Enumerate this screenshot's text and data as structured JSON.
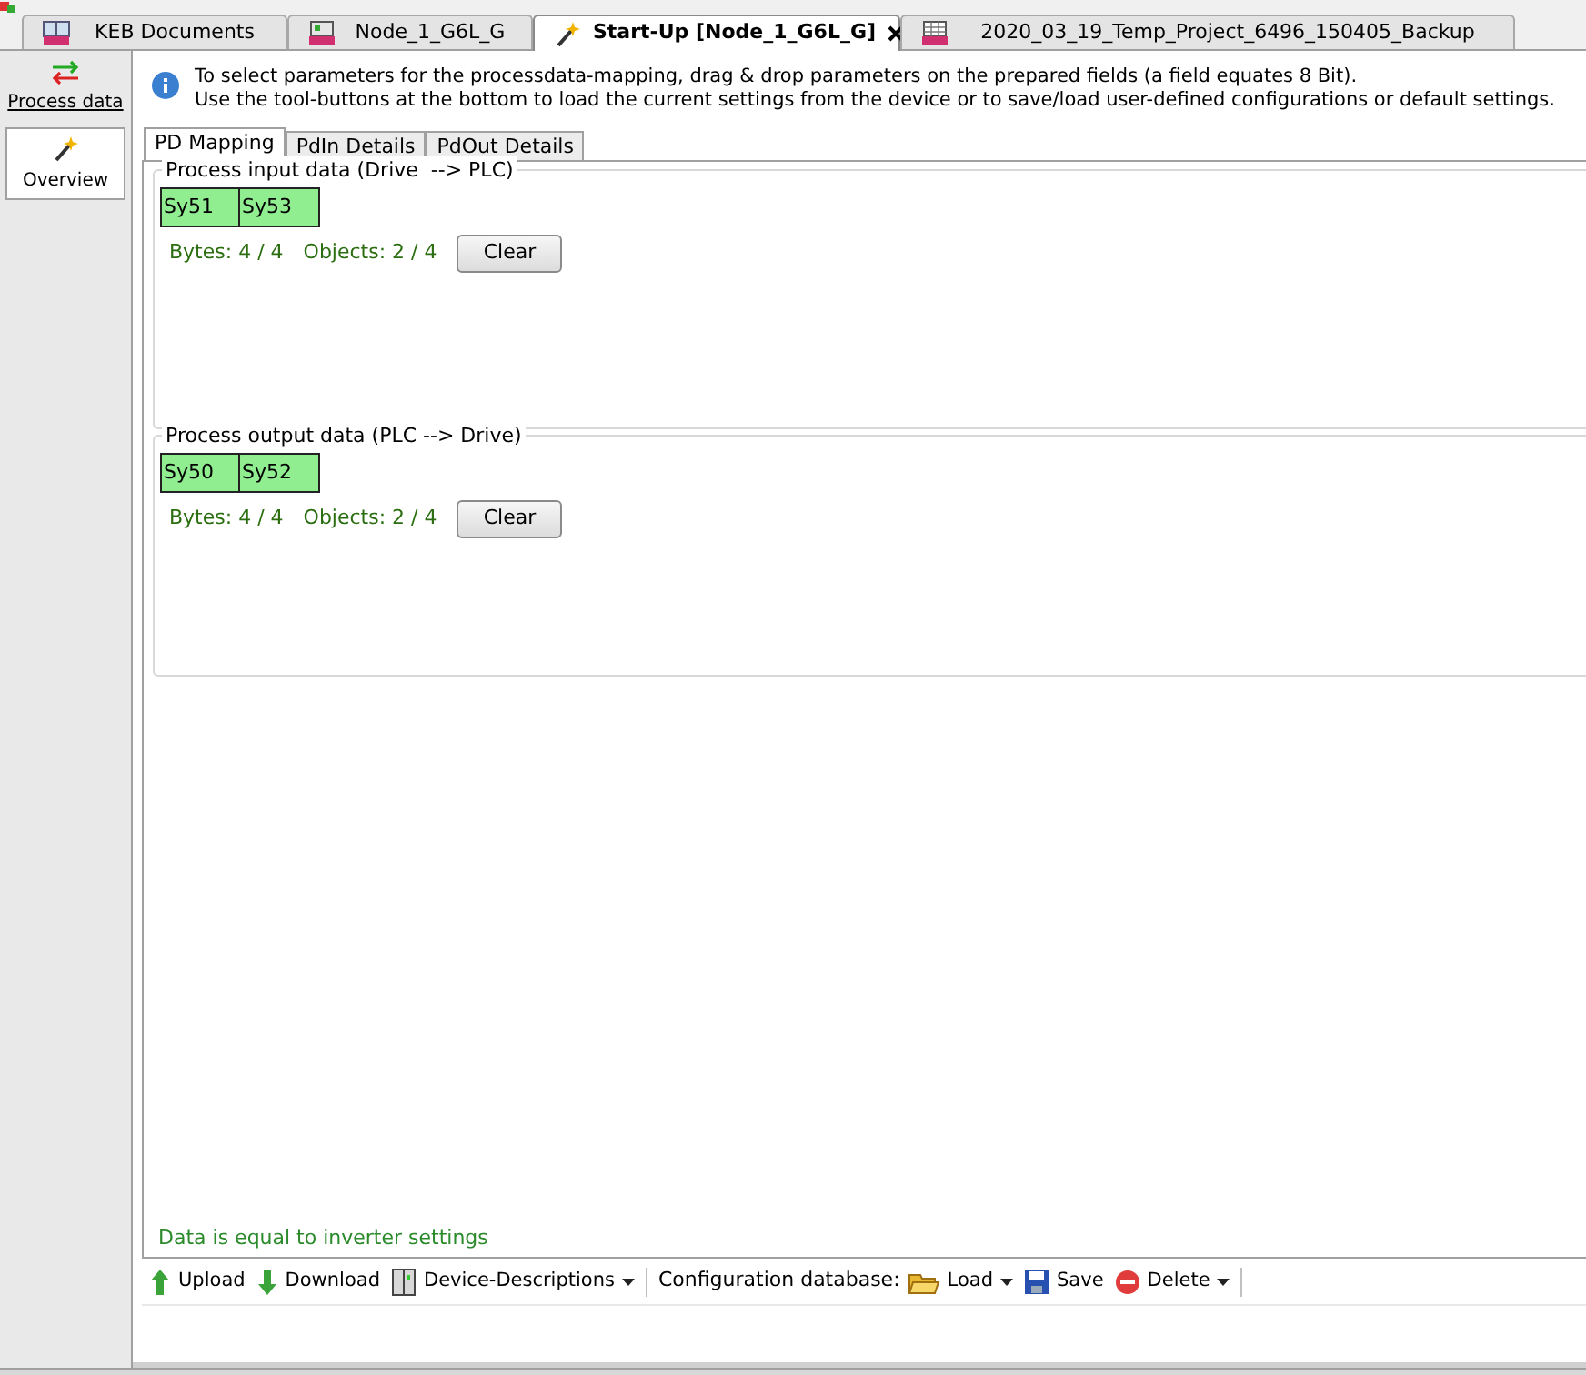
{
  "document_tabs": [
    {
      "label": "KEB Documents",
      "kind": "keb",
      "selected": false
    },
    {
      "label": "Node_1_G6L_G",
      "kind": "node",
      "selected": false
    },
    {
      "label": "Start-Up [Node_1_G6L_G]",
      "kind": "wand",
      "selected": true
    },
    {
      "label": "2020_03_19_Temp_Project_6496_150405_Backup",
      "kind": "project",
      "selected": false
    }
  ],
  "sidebar": {
    "items": [
      {
        "label": "Process data",
        "kind": "arrows",
        "selected": false
      },
      {
        "label": "Overview",
        "kind": "wand",
        "selected": true
      }
    ]
  },
  "info_lines": [
    "To select parameters for the processdata-mapping, drag & drop parameters on the prepared fields (a field equates 8 Bit).",
    "Use the tool-buttons at the bottom to load the current settings from the device or to save/load user-defined configurations or default settings."
  ],
  "tabs": [
    {
      "label": "PD Mapping",
      "selected": true
    },
    {
      "label": "PdIn Details",
      "selected": false
    },
    {
      "label": "PdOut Details",
      "selected": false
    }
  ],
  "groups": [
    {
      "title": "Process input data (Drive  --> PLC)",
      "fields": [
        "Sy51",
        "Sy53"
      ],
      "bytes": "Bytes: 4 / 4",
      "objects": "Objects: 2 / 4",
      "button": "Clear"
    },
    {
      "title": "Process output data (PLC --> Drive)",
      "fields": [
        "Sy50",
        "Sy52"
      ],
      "bytes": "Bytes: 4 / 4",
      "objects": "Objects: 2 / 4",
      "button": "Clear"
    }
  ],
  "status": "Data is equal to inverter settings",
  "toolbar": [
    {
      "kind": "up",
      "label": "Upload",
      "dropdown": false
    },
    {
      "kind": "down",
      "label": "Download",
      "dropdown": false
    },
    {
      "kind": "device",
      "label": "Device-Descriptions",
      "dropdown": true
    },
    {
      "kind": "separator"
    },
    {
      "kind": "label",
      "label": "Configuration database:"
    },
    {
      "kind": "folder",
      "label": "Load",
      "dropdown": true
    },
    {
      "kind": "disk",
      "label": "Save",
      "dropdown": false
    },
    {
      "kind": "delete",
      "label": "Delete",
      "dropdown": true
    },
    {
      "kind": "separator"
    }
  ]
}
